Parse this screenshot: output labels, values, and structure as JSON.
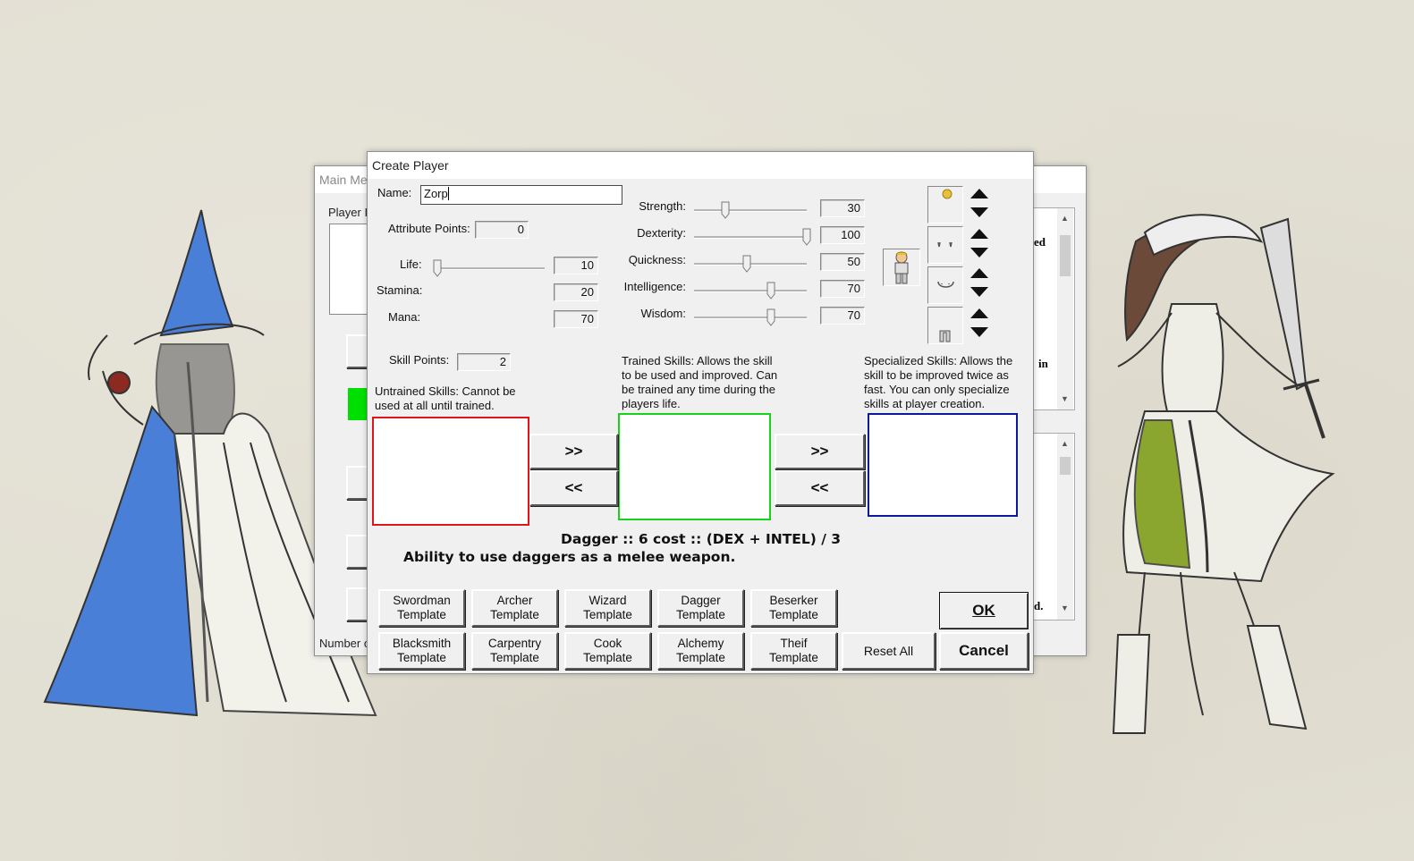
{
  "background_window": {
    "title": "Main Me",
    "player_label": "Player I",
    "status_text": "Number o",
    "right_text_1": "ed",
    "right_text_2": "in",
    "right_text_3": "d."
  },
  "dialog": {
    "title": "Create Player",
    "name_label": "Name:",
    "name_value": "Zorp",
    "attribute_points_label": "Attribute Points:",
    "attribute_points_value": "0",
    "life_label": "Life:",
    "life_value": "10",
    "stamina_label": "Stamina:",
    "stamina_value": "20",
    "mana_label": "Mana:",
    "mana_value": "70",
    "attributes": [
      {
        "label": "Strength:",
        "value": "30",
        "level": 0.28
      },
      {
        "label": "Dexterity:",
        "value": "100",
        "level": 1.0
      },
      {
        "label": "Quickness:",
        "value": "50",
        "level": 0.47
      },
      {
        "label": "Intelligence:",
        "value": "70",
        "level": 0.68
      },
      {
        "label": "Wisdom:",
        "value": "70",
        "level": 0.68
      }
    ],
    "life_level": 0.0,
    "skill_points_label": "Skill Points:",
    "skill_points_value": "2",
    "untrained_desc": "Untrained Skills: Cannot be used at all until trained.",
    "trained_desc": "Trained Skills: Allows the skill to be used and improved. Can be trained any time during the players life.",
    "specialized_desc": "Specialized Skills: Allows the skill to be improved twice as fast. You can only specialize skills at player creation.",
    "move_right_label": ">>",
    "move_left_label": "<<",
    "skill_title": "Dagger :: 6 cost :: (DEX + INTEL) / 3",
    "skill_description": "Ability to use daggers as a melee weapon.",
    "templates_row1": [
      {
        "line1": "Swordman",
        "line2": "Template"
      },
      {
        "line1": "Archer",
        "line2": "Template"
      },
      {
        "line1": "Wizard",
        "line2": "Template"
      },
      {
        "line1": "Dagger",
        "line2": "Template"
      },
      {
        "line1": "Beserker",
        "line2": "Template"
      }
    ],
    "templates_row2": [
      {
        "line1": "Blacksmith",
        "line2": "Template"
      },
      {
        "line1": "Carpentry",
        "line2": "Template"
      },
      {
        "line1": "Cook",
        "line2": "Template"
      },
      {
        "line1": "Alchemy",
        "line2": "Template"
      },
      {
        "line1": "Theif",
        "line2": "Template"
      }
    ],
    "reset_label": "Reset All",
    "ok_label": "OK",
    "cancel_label": "Cancel"
  },
  "colors": {
    "untrained_border": "#e0141c",
    "trained_border": "#18d418",
    "specialized_border": "#0a1a9c",
    "green_indicator": "#00e000",
    "wizard_robe": "#4a7fd8",
    "warrior_skirt": "#7a9a10"
  }
}
